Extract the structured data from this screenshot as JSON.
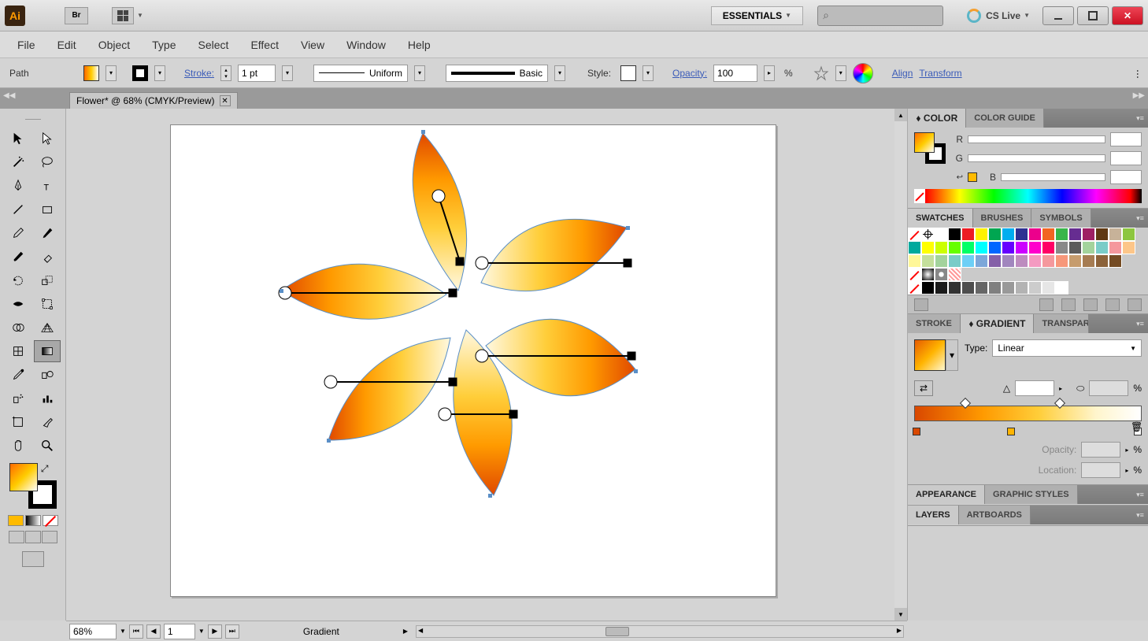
{
  "app": {
    "icon_text": "Ai",
    "bridge": "Br"
  },
  "workspace": {
    "label": "ESSENTIALS"
  },
  "cslive": {
    "label": "CS Live"
  },
  "menu": [
    "File",
    "Edit",
    "Object",
    "Type",
    "Select",
    "Effect",
    "View",
    "Window",
    "Help"
  ],
  "control": {
    "selection": "Path",
    "stroke_label": "Stroke:",
    "stroke_weight": "1 pt",
    "profile": "Uniform",
    "brush": "Basic",
    "style_label": "Style:",
    "opacity_label": "Opacity:",
    "opacity_value": "100",
    "opacity_unit": "%",
    "align": "Align",
    "transform": "Transform"
  },
  "doc_tab": {
    "title": "Flower* @ 68% (CMYK/Preview)"
  },
  "status": {
    "zoom": "68%",
    "page": "1",
    "tool": "Gradient"
  },
  "panels": {
    "color": {
      "tab1": "COLOR",
      "tab2": "COLOR GUIDE",
      "r": "R",
      "g": "G",
      "b": "B"
    },
    "swatches": {
      "tab1": "SWATCHES",
      "tab2": "BRUSHES",
      "tab3": "SYMBOLS"
    },
    "gradient": {
      "tab1": "STROKE",
      "tab2": "GRADIENT",
      "tab3": "TRANSPARENCY",
      "type_label": "Type:",
      "type_value": "Linear",
      "opacity_label": "Opacity:",
      "location_label": "Location:",
      "pct": "%"
    },
    "appearance": {
      "tab1": "APPEARANCE",
      "tab2": "GRAPHIC STYLES"
    },
    "layers": {
      "tab1": "LAYERS",
      "tab2": "ARTBOARDS"
    }
  },
  "swatch_colors": [
    "#ffffff",
    "#000000",
    "#ed1c24",
    "#fff200",
    "#00a651",
    "#00aeef",
    "#2e3192",
    "#ec008c",
    "#f26522",
    "#39b54a",
    "#662d91",
    "#9e1f63",
    "#603913",
    "#c7b299",
    "#8dc63f",
    "#00a99d",
    "#ffff00",
    "#ccff00",
    "#66ff00",
    "#00ff66",
    "#00ffff",
    "#0066ff",
    "#6600ff",
    "#cc00ff",
    "#ff00cc",
    "#ff0066",
    "#898989",
    "#5b5b5b",
    "#a3d39c",
    "#7accc8",
    "#f5989d",
    "#fdc689",
    "#fff799",
    "#c4df9b",
    "#a3d39c",
    "#7accc8",
    "#6dcff6",
    "#7da7d9",
    "#8560a8",
    "#a186be",
    "#bd8cbf",
    "#f49ac1",
    "#f5989d",
    "#f7977a",
    "#c69c6d",
    "#a67c52",
    "#8c6239",
    "#754c24"
  ],
  "gray_swatches": [
    "#000000",
    "#1a1a1a",
    "#333333",
    "#4d4d4d",
    "#666666",
    "#808080",
    "#999999",
    "#b3b3b3",
    "#cccccc",
    "#e6e6e6",
    "#ffffff"
  ]
}
